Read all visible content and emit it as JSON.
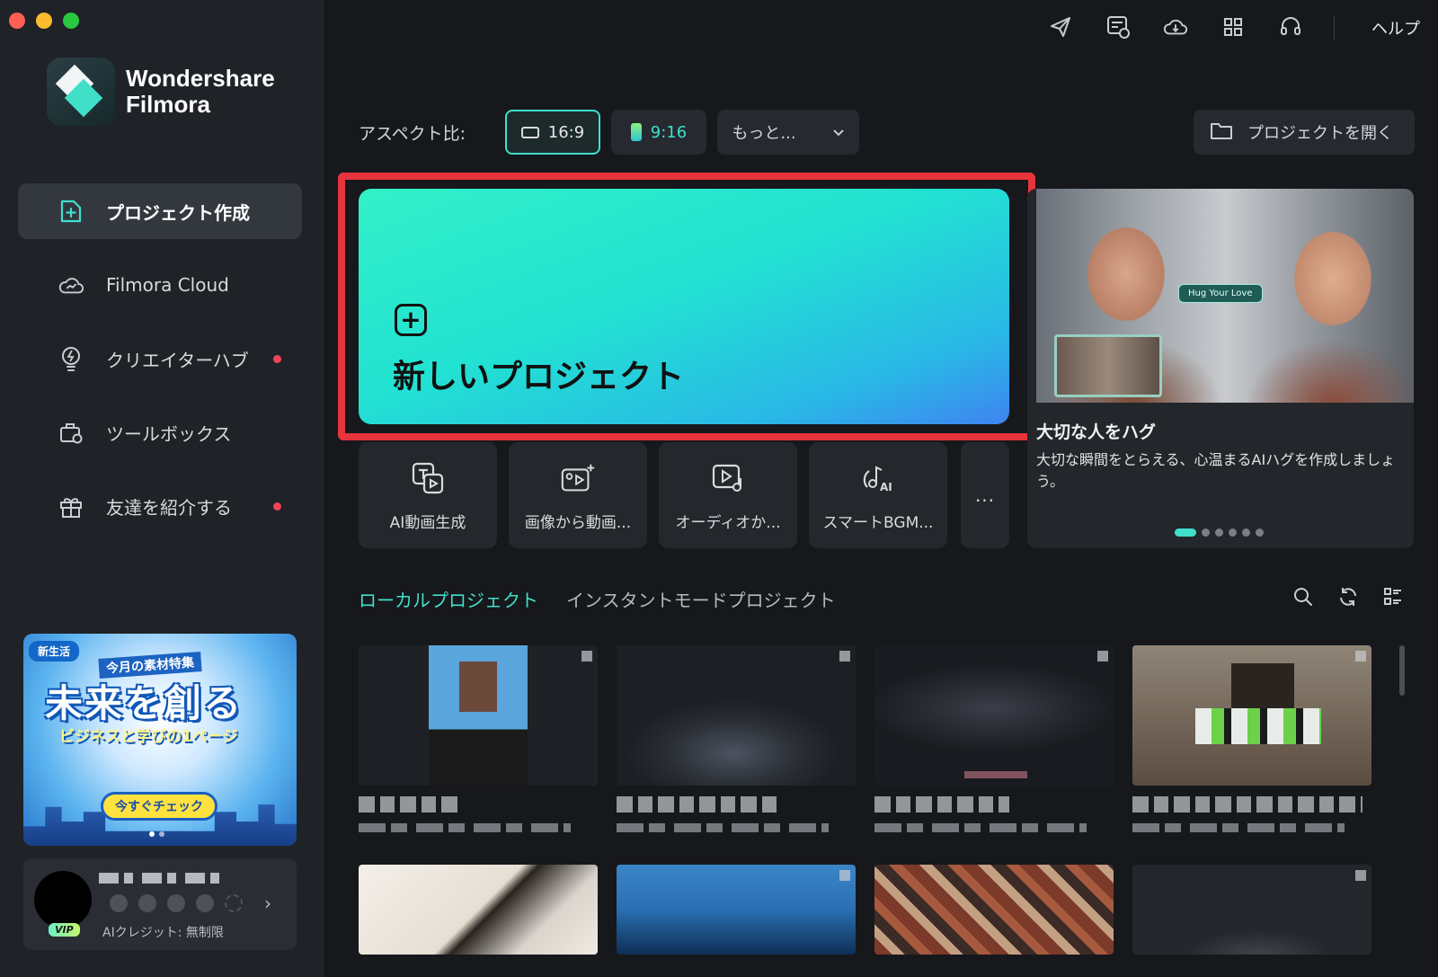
{
  "window": {
    "traffic_lights": [
      "close",
      "minimize",
      "zoom"
    ]
  },
  "brand": {
    "line1": "Wondershare",
    "line2": "Filmora"
  },
  "sidebar": {
    "items": [
      {
        "label": "プロジェクト作成",
        "icon": "new-project-icon",
        "active": true,
        "dot": false
      },
      {
        "label": "Filmora Cloud",
        "icon": "cloud-icon",
        "active": false,
        "dot": false
      },
      {
        "label": "クリエイターハブ",
        "icon": "bulb-icon",
        "active": false,
        "dot": true
      },
      {
        "label": "ツールボックス",
        "icon": "toolbox-icon",
        "active": false,
        "dot": false
      },
      {
        "label": "友達を紹介する",
        "icon": "gift-icon",
        "active": false,
        "dot": true
      }
    ],
    "promo": {
      "tag": "新生活",
      "subtitle": "今月の素材特集",
      "headline": "未来を創る",
      "tagline": "ビジネスと学びの1ページ",
      "cta": "今すぐチェック"
    },
    "user": {
      "badge": "VIP",
      "credit": "AIクレジット: 無制限"
    }
  },
  "topbar": {
    "icons": [
      "send-icon",
      "tasks-icon",
      "cloud-download-icon",
      "apps-grid-icon",
      "headset-icon"
    ],
    "help": "ヘルプ"
  },
  "aspect": {
    "label": "アスペクト比:",
    "options": [
      {
        "label": "16:9",
        "selected": true
      },
      {
        "label": "9:16",
        "selected": false
      }
    ],
    "more": "もっと...",
    "open_project": "プロジェクトを開く"
  },
  "hero": {
    "label": "新しいプロジェクト"
  },
  "tools": [
    {
      "label": "AI動画生成",
      "icon": "ai-text-video-icon"
    },
    {
      "label": "画像から動画...",
      "icon": "image-to-video-icon"
    },
    {
      "label": "オーディオか...",
      "icon": "audio-video-icon"
    },
    {
      "label": "スマートBGM...",
      "icon": "ai-music-icon"
    }
  ],
  "tools_more": "...",
  "feature": {
    "badge": "Hug Your Love",
    "title": "大切な人をハグ",
    "description": "大切な瞬間をとらえる、心温まるAIハグを作成しましょう。",
    "page_count": 6,
    "current_page": 1
  },
  "tabs": [
    {
      "label": "ローカルプロジェクト",
      "active": true
    },
    {
      "label": "インスタントモードプロジェクト",
      "active": false
    }
  ],
  "tab_tools": [
    "search-icon",
    "refresh-icon",
    "list-view-icon"
  ],
  "colors": {
    "accent": "#3fe0c9",
    "highlight": "#e8343c",
    "bg": "#16181c",
    "sidebar": "#1f2227"
  }
}
